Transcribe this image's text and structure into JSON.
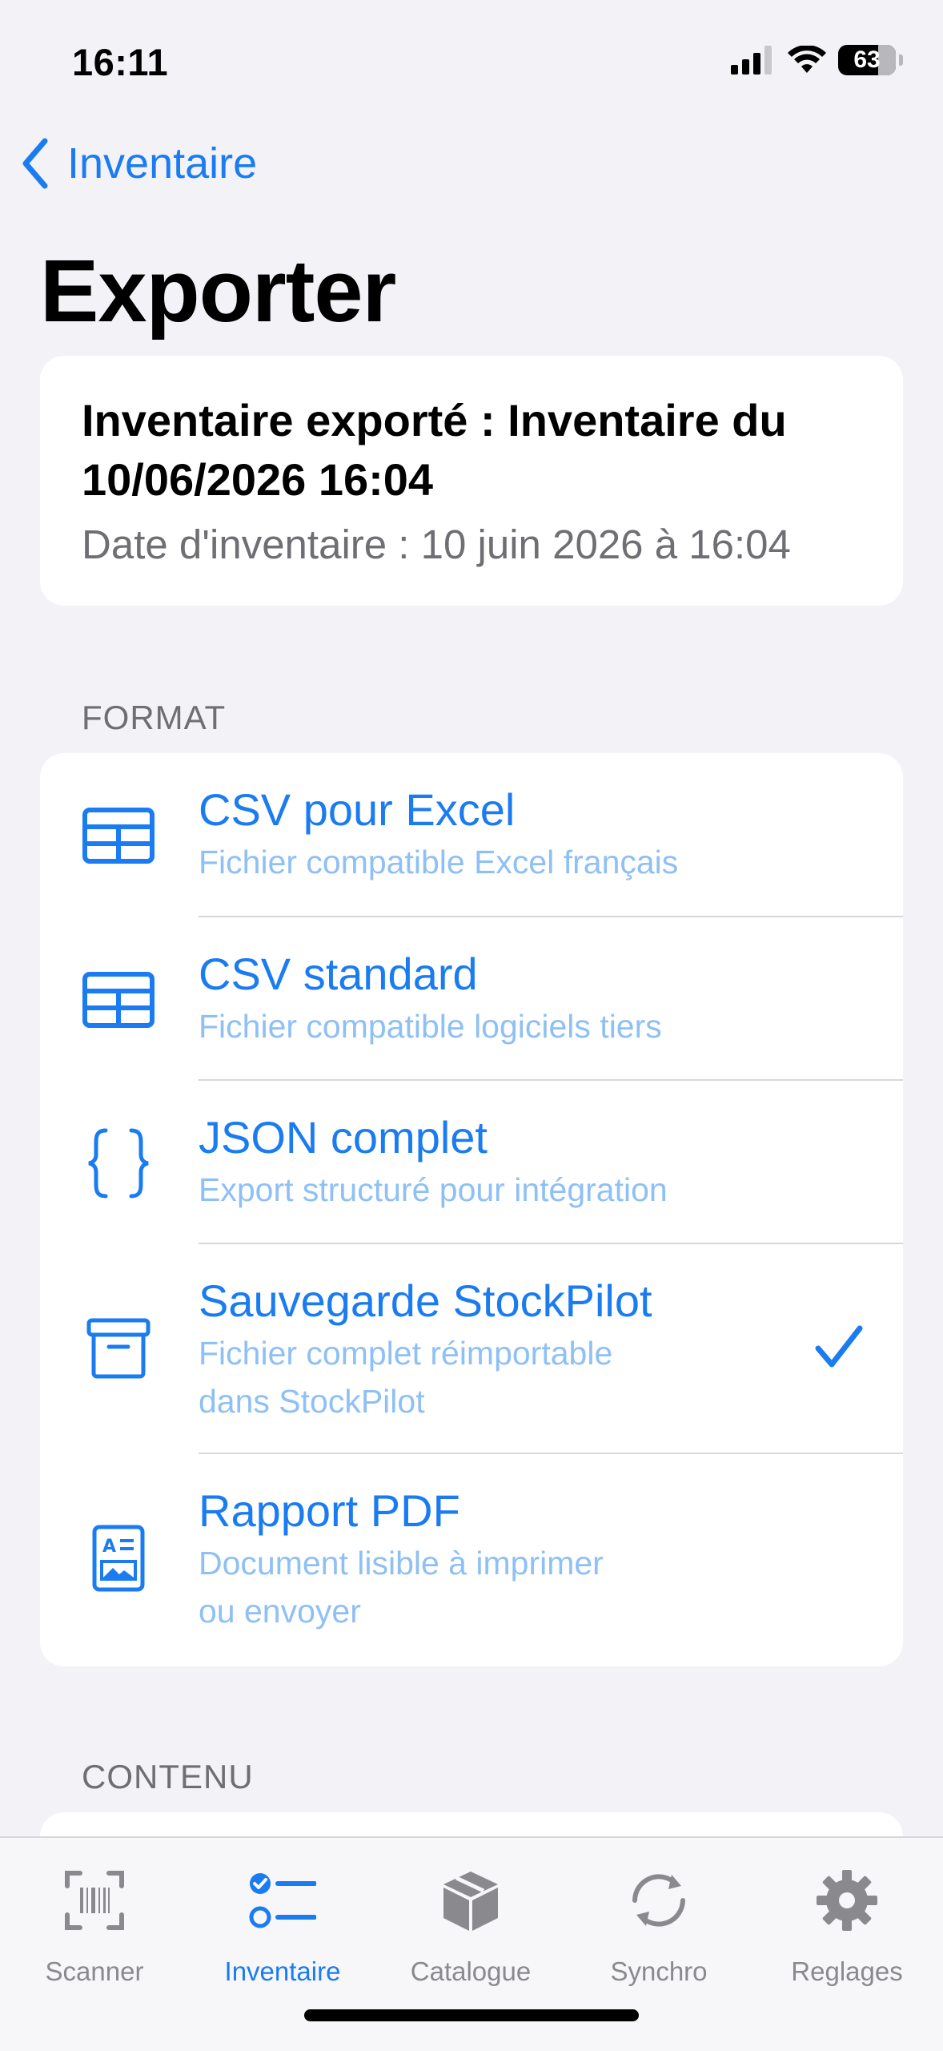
{
  "status_bar": {
    "time": "16:11",
    "battery": "63",
    "icons": [
      "cellular-signal-icon",
      "wifi-icon",
      "battery-icon"
    ]
  },
  "nav": {
    "back_label": "Inventaire"
  },
  "page": {
    "title": "Exporter"
  },
  "summary": {
    "title_line1": "Inventaire exporté : Inventaire du",
    "title_line2": "10/06/2026 16:04",
    "date_text": "Date d'inventaire : 10 juin 2026 à 16:04"
  },
  "format_section": {
    "header": "FORMAT",
    "options": [
      {
        "title": "CSV pour Excel",
        "subtitle_line1": "Fichier compatible Excel français",
        "icon": "table-icon",
        "selected": false
      },
      {
        "title": "CSV standard",
        "subtitle_line1": "Fichier compatible logiciels tiers",
        "icon": "table-icon",
        "selected": false
      },
      {
        "title": "JSON complet",
        "subtitle_line1": "Export structuré pour intégration",
        "icon": "curly-braces-icon",
        "selected": false
      },
      {
        "title": "Sauvegarde StockPilot",
        "subtitle_line1": "Fichier complet réimportable",
        "subtitle_line2": "dans StockPilot",
        "icon": "archive-box-icon",
        "selected": true
      },
      {
        "title": "Rapport PDF",
        "subtitle_line1": "Document lisible à imprimer",
        "subtitle_line2": "ou envoyer",
        "icon": "document-image-icon",
        "selected": false
      }
    ]
  },
  "content_section": {
    "header": "CONTENU"
  },
  "tab_bar": {
    "tabs": [
      {
        "label": "Scanner",
        "icon": "barcode-scanner-icon",
        "active": false
      },
      {
        "label": "Inventaire",
        "icon": "checklist-icon",
        "active": true
      },
      {
        "label": "Catalogue",
        "icon": "package-box-icon",
        "active": false
      },
      {
        "label": "Synchro",
        "icon": "sync-arrows-icon",
        "active": false
      },
      {
        "label": "Reglages",
        "icon": "gear-icon",
        "active": false
      }
    ]
  },
  "colors": {
    "accent": "#1a7cf0",
    "accent_light": "#8fc0f5",
    "background": "#f2f2f7",
    "secondary_text": "#6e6e73",
    "inactive_tab": "#8a8a8e"
  }
}
